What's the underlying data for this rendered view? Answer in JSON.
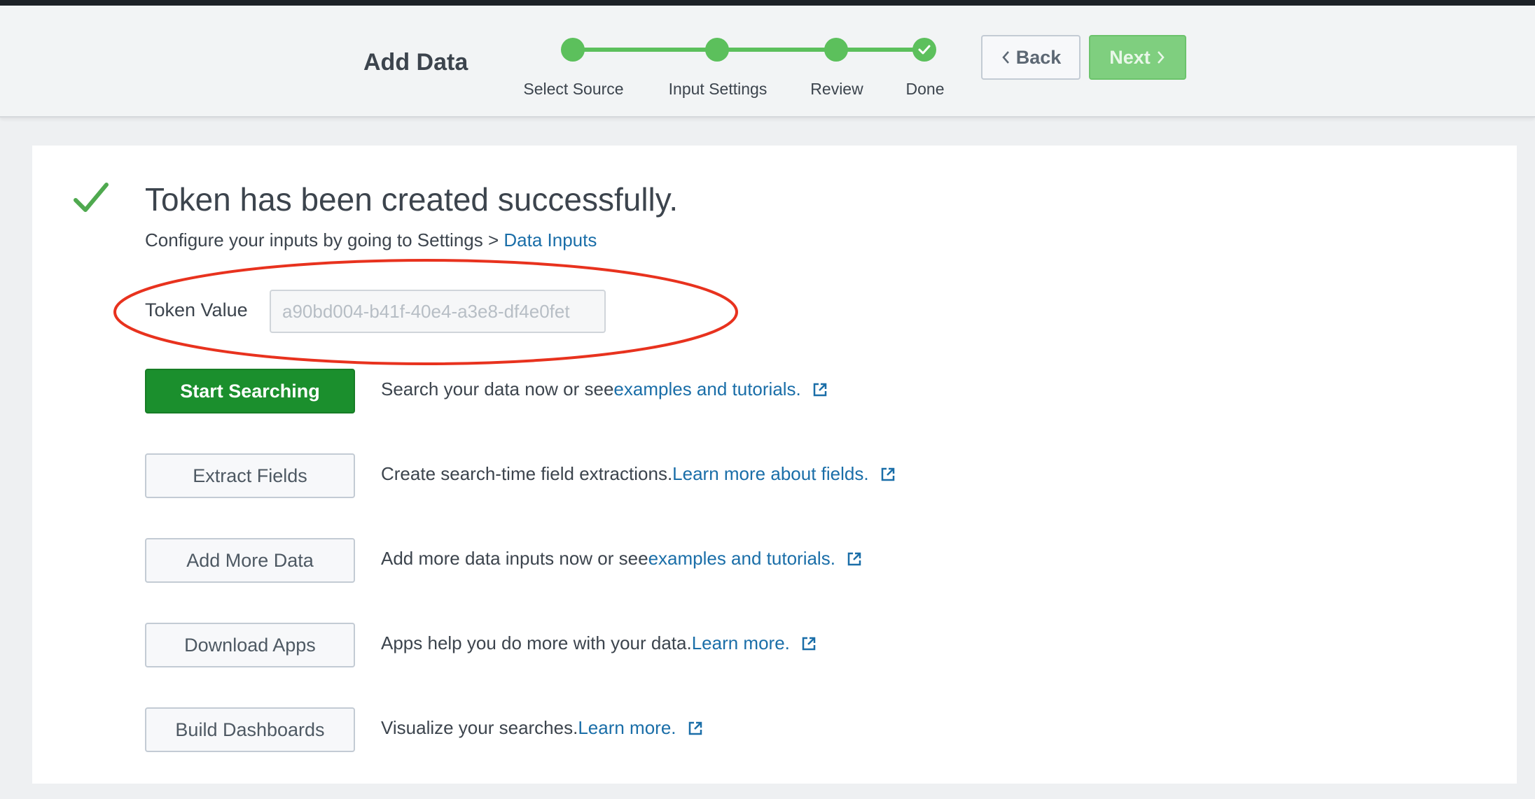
{
  "header": {
    "title": "Add Data",
    "steps": [
      {
        "label": "Select Source",
        "state": "complete"
      },
      {
        "label": "Input Settings",
        "state": "complete"
      },
      {
        "label": "Review",
        "state": "complete"
      },
      {
        "label": "Done",
        "state": "current-complete"
      }
    ],
    "back_label": "Back",
    "next_label": "Next",
    "next_enabled": false
  },
  "main": {
    "success_title": "Token has been created successfully.",
    "configure_text": "Configure your inputs by going to Settings > ",
    "configure_link": "Data Inputs",
    "token_label": "Token Value",
    "token_value": "a90bd004-b41f-40e4-a3e8-df4e0fet",
    "actions": [
      {
        "button": "Start Searching",
        "style": "primary",
        "text": "Search your data now or see ",
        "link": "examples and tutorials.",
        "icon": "external-link-icon"
      },
      {
        "button": "Extract Fields",
        "style": "secondary",
        "text": "Create search-time field extractions. ",
        "link": "Learn more about fields.",
        "icon": "external-link-icon"
      },
      {
        "button": "Add More Data",
        "style": "secondary",
        "text": "Add more data inputs now or see ",
        "link": "examples and tutorials.",
        "icon": "external-link-icon"
      },
      {
        "button": "Download Apps",
        "style": "secondary",
        "text": "Apps help you do more with your data. ",
        "link": "Learn more.",
        "icon": "external-link-icon"
      },
      {
        "button": "Build Dashboards",
        "style": "secondary",
        "text": "Visualize your searches. ",
        "link": "Learn more.",
        "icon": "external-link-icon"
      }
    ]
  },
  "colors": {
    "success_green": "#5cc05c",
    "primary_button": "#1b8f2d",
    "link_blue": "#1a6ea8",
    "annotation_red": "#e8321e"
  }
}
